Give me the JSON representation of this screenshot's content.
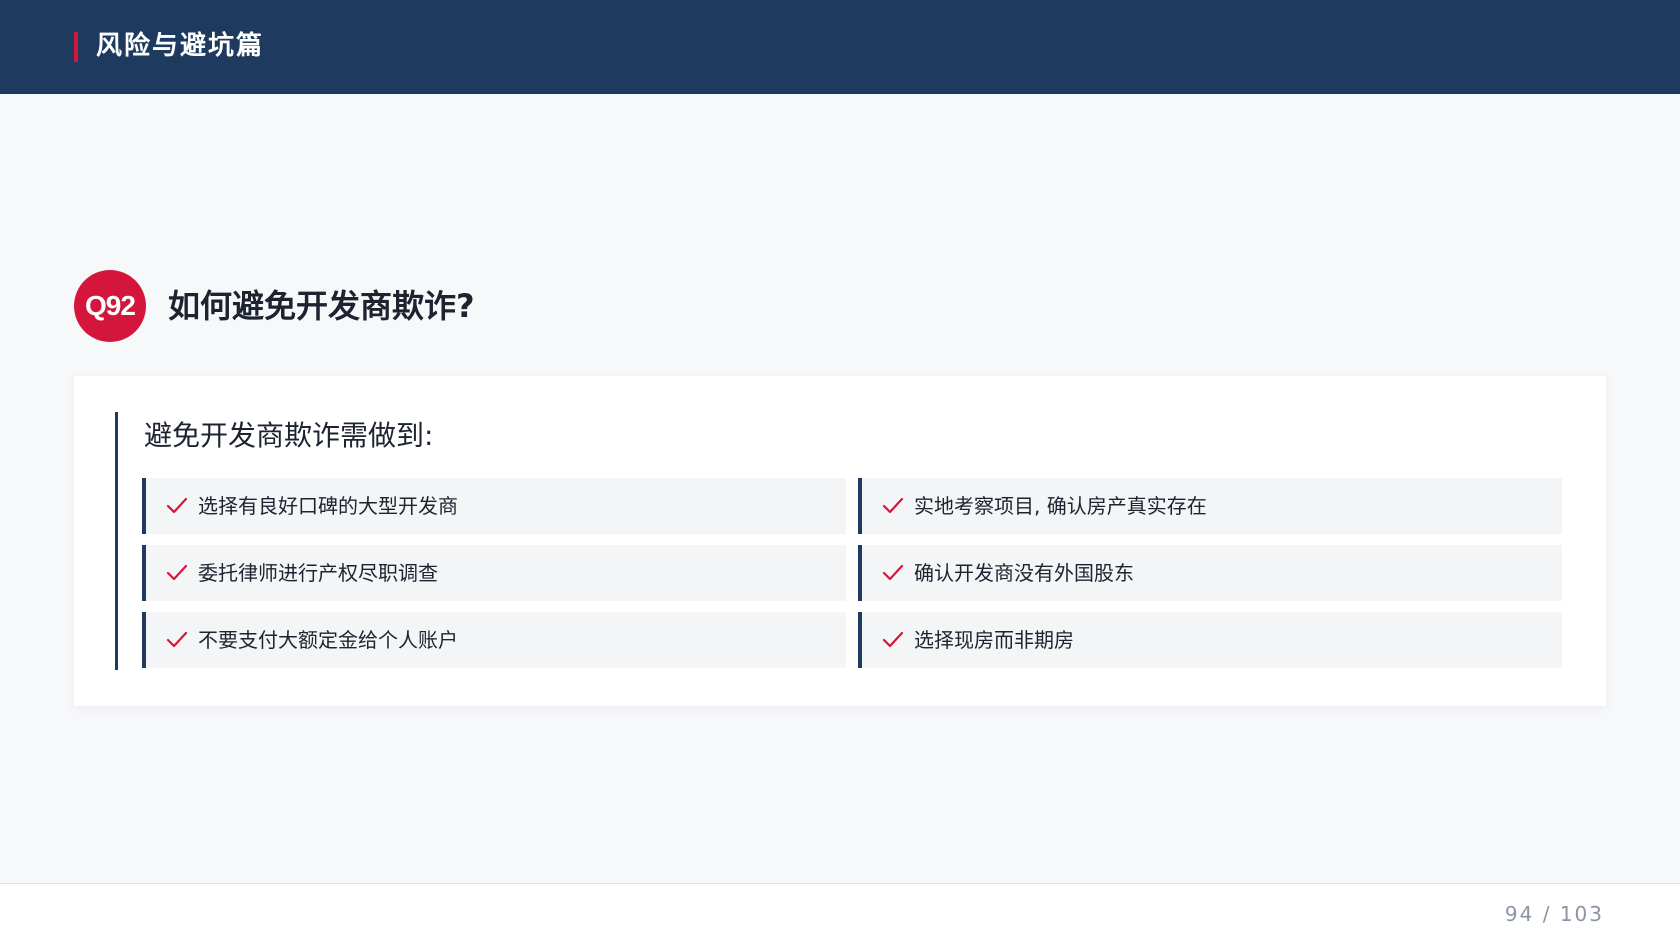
{
  "header": {
    "title": "风险与避坑篇"
  },
  "question": {
    "badge": "Q92",
    "title": "如何避免开发商欺诈?"
  },
  "card": {
    "heading": "避免开发商欺诈需做到:",
    "items": [
      {
        "label": "选择有良好口碑的大型开发商",
        "icon": "check-icon"
      },
      {
        "label": "实地考察项目, 确认房产真实存在",
        "icon": "check-icon"
      },
      {
        "label": "委托律师进行产权尽职调查",
        "icon": "check-icon"
      },
      {
        "label": "确认开发商没有外国股东",
        "icon": "check-icon"
      },
      {
        "label": "不要支付大额定金给个人账户",
        "icon": "check-icon"
      },
      {
        "label": "选择现房而非期房",
        "icon": "check-icon"
      }
    ]
  },
  "footer": {
    "page_number": "94 / 103"
  },
  "colors": {
    "header_bg": "#1f3a5f",
    "accent_red": "#d4163c",
    "item_bg": "#f4f5f7",
    "page_bg": "#f7f8fa"
  }
}
